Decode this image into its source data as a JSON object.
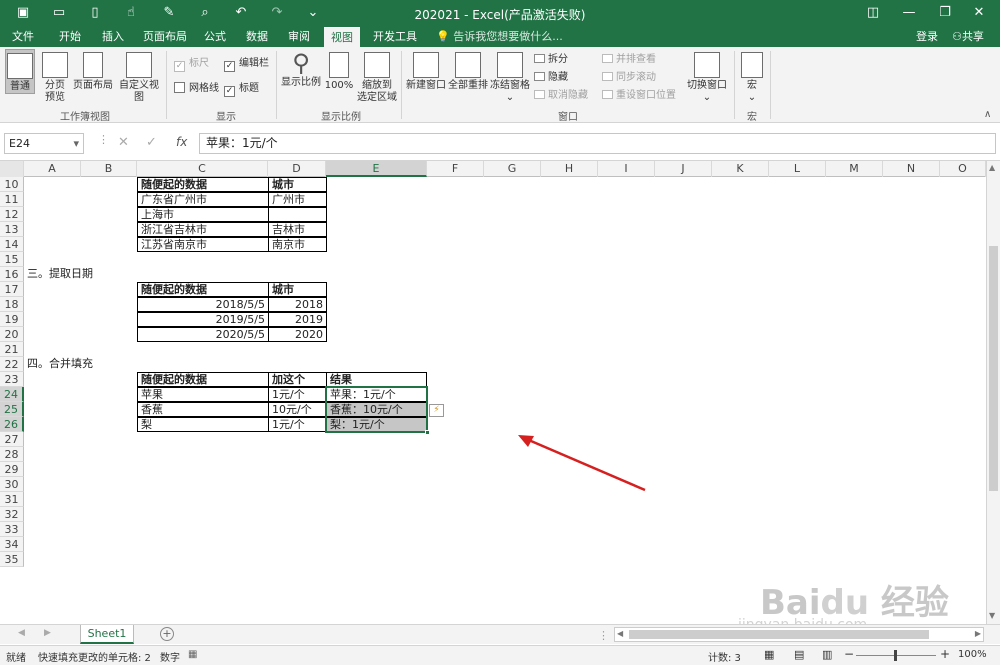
{
  "window": {
    "title": "202021 - Excel(产品激活失败)",
    "login": "登录",
    "share": "共享"
  },
  "tabs": [
    "文件",
    "开始",
    "插入",
    "页面布局",
    "公式",
    "数据",
    "审阅",
    "视图",
    "开发工具"
  ],
  "tellme": "告诉我您想要做什么...",
  "ribbon": {
    "workbook_views": {
      "normal": "普通",
      "page_break": "分页\n预览",
      "page_layout": "页面布局",
      "custom": "自定义视图",
      "label": "工作簿视图"
    },
    "show": {
      "ruler": "标尺",
      "formula_bar": "编辑栏",
      "gridlines": "网格线",
      "headings": "标题",
      "label": "显示"
    },
    "zoom": {
      "zoom": "显示比例",
      "hundred": "100%",
      "to_selection": "缩放到\n选定区域",
      "label": "显示比例"
    },
    "window": {
      "new": "新建窗口",
      "arrange": "全部重排",
      "freeze": "冻结窗格",
      "split": "拆分",
      "hide": "隐藏",
      "unhide": "取消隐藏",
      "side_by_side": "并排查看",
      "sync": "同步滚动",
      "reset": "重设窗口位置",
      "switch": "切换窗口",
      "label": "窗口"
    },
    "macros": {
      "macro": "宏",
      "label": "宏"
    }
  },
  "formula_bar": {
    "name_box": "E24",
    "formula": "苹果：1元/个",
    "fx": "fx"
  },
  "columns": [
    "A",
    "B",
    "C",
    "D",
    "E",
    "F",
    "G",
    "H",
    "I",
    "J",
    "K",
    "L",
    "M",
    "N",
    "O"
  ],
  "rows": [
    "10",
    "11",
    "12",
    "13",
    "14",
    "15",
    "16",
    "17",
    "18",
    "19",
    "20",
    "21",
    "22",
    "23",
    "24",
    "25",
    "26",
    "27",
    "28",
    "29",
    "30",
    "31",
    "32",
    "33",
    "34",
    "35"
  ],
  "sections": {
    "s3": "三。提取日期",
    "s4": "四。合并填充"
  },
  "table1": {
    "headers": [
      "随便起的数据",
      "城市"
    ],
    "rows": [
      [
        "广东省广州市",
        "广州市"
      ],
      [
        "上海市",
        ""
      ],
      [
        "浙江省吉林市",
        "吉林市"
      ],
      [
        "江苏省南京市",
        "南京市"
      ]
    ]
  },
  "table2": {
    "headers": [
      "随便起的数据",
      "城市"
    ],
    "rows": [
      [
        "2018/5/5",
        "2018"
      ],
      [
        "2019/5/5",
        "2019"
      ],
      [
        "2020/5/5",
        "2020"
      ]
    ]
  },
  "table3": {
    "headers": [
      "随便起的数据",
      "加这个",
      "结果"
    ],
    "rows": [
      [
        "苹果",
        "1元/个",
        "苹果：1元/个"
      ],
      [
        "香蕉",
        "10元/个",
        "香蕉：10元/个"
      ],
      [
        "梨",
        "1元/个",
        "梨：1元/个"
      ]
    ]
  },
  "sheet_tab": "Sheet1",
  "status": {
    "ready": "就绪",
    "flash": "快速填充更改的单元格: 2",
    "mode": "数字",
    "count": "计数: 3",
    "zoom": "100%"
  },
  "watermark": "Baidu经验 jingyan.baidu.com"
}
